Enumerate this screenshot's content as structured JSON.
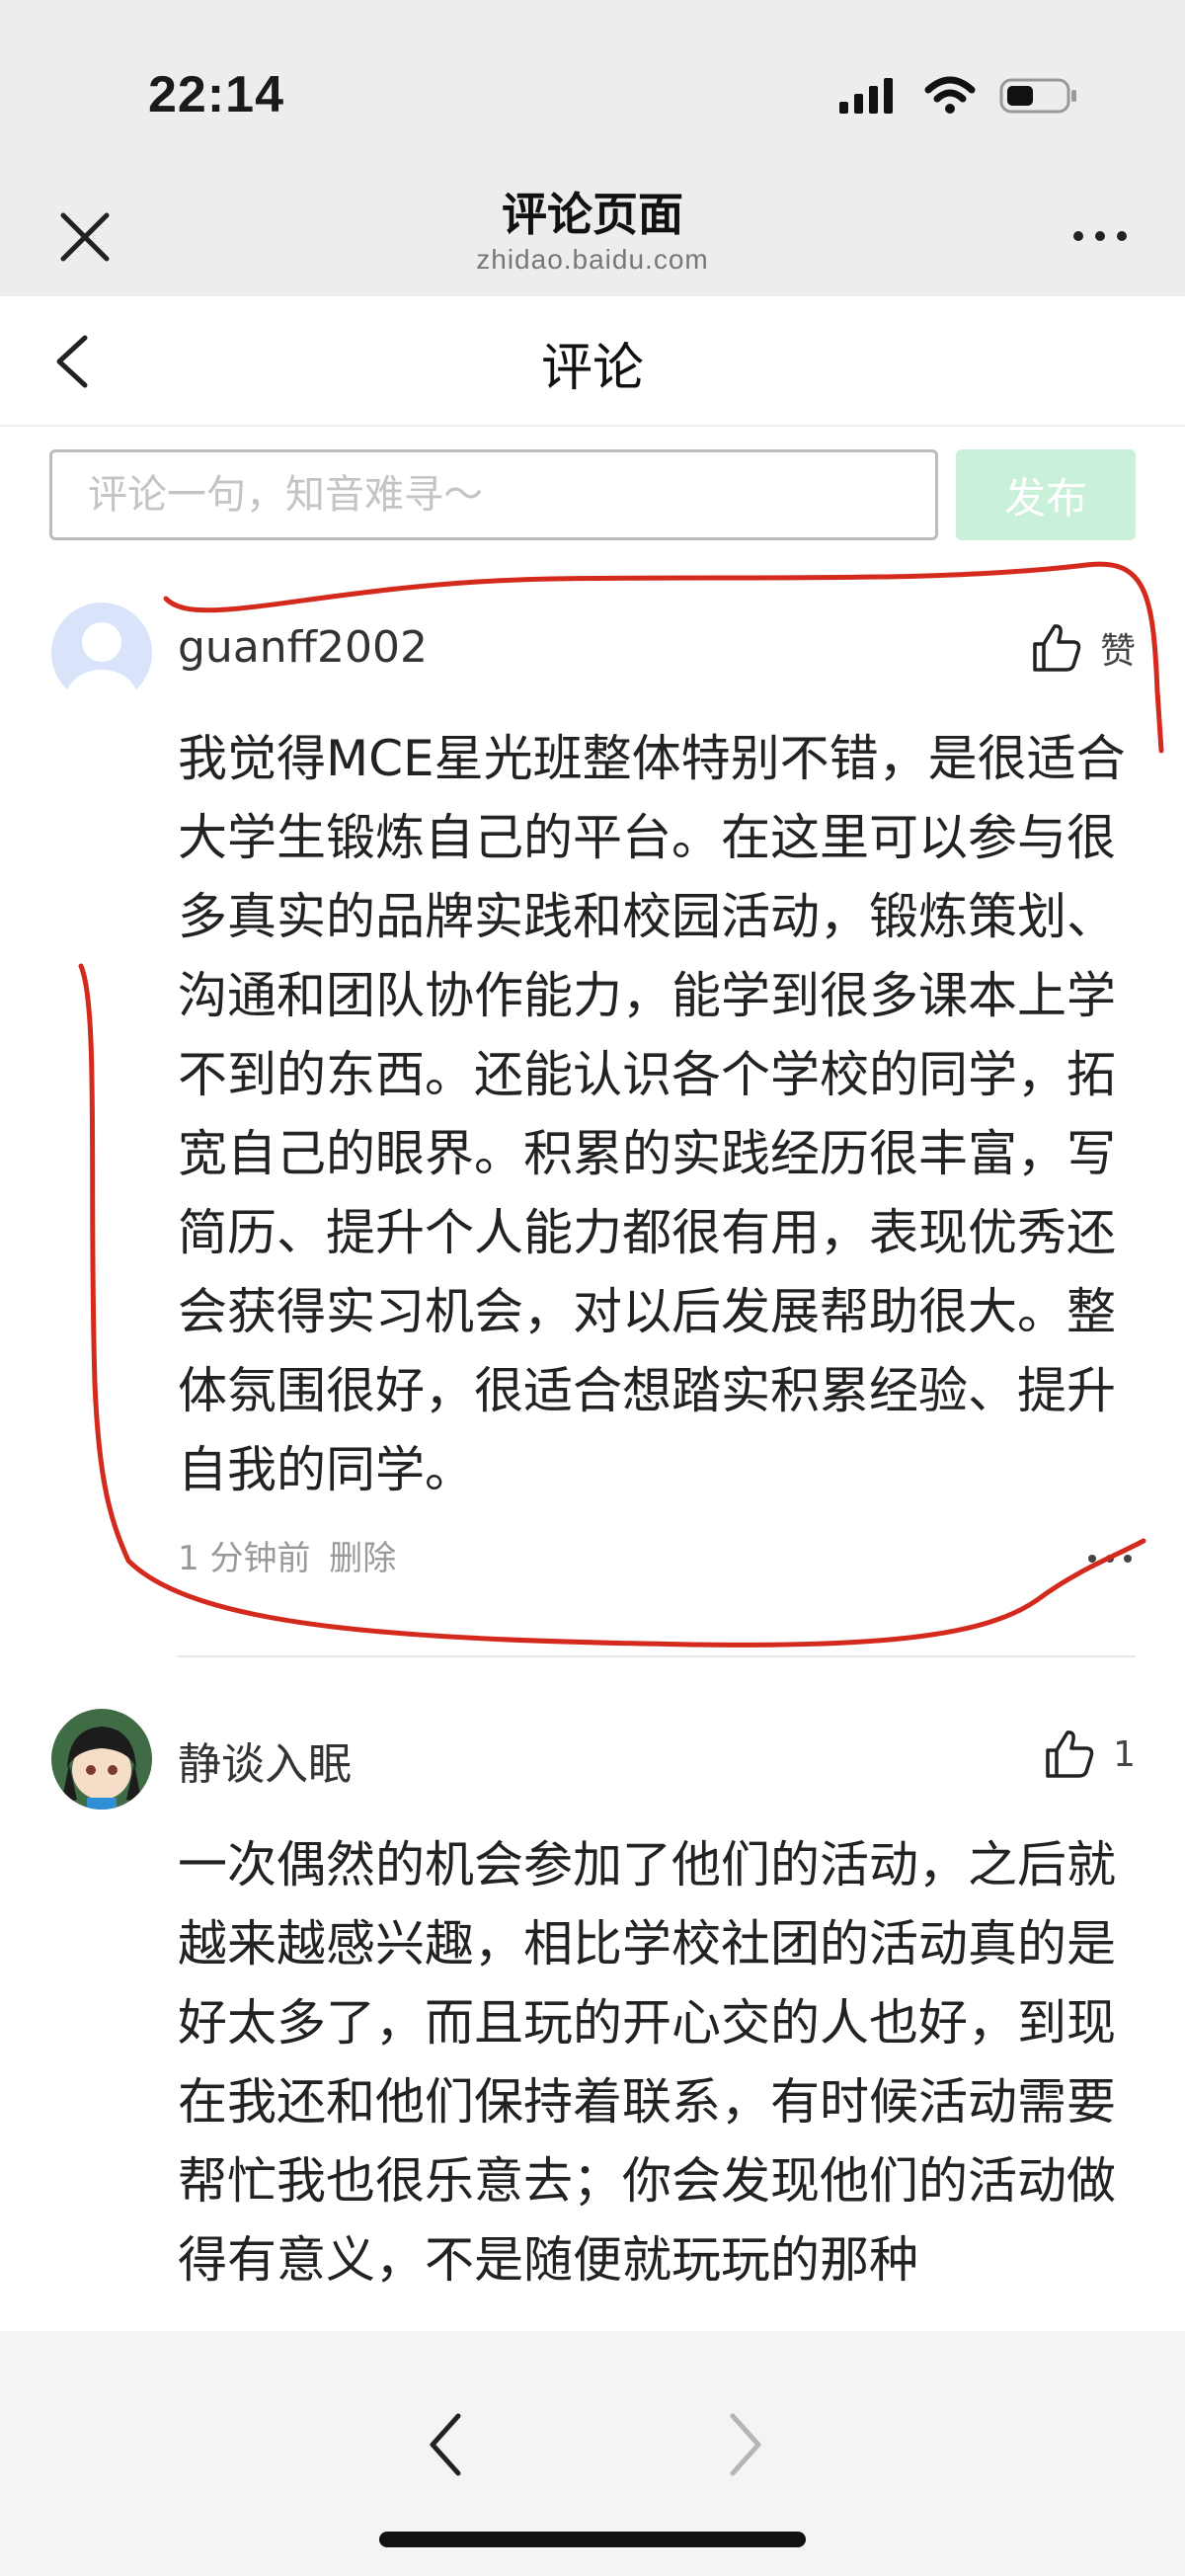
{
  "status_bar": {
    "time": "22:14"
  },
  "browser": {
    "title": "评论页面",
    "domain": "zhidao.baidu.com"
  },
  "header": {
    "title": "评论"
  },
  "comment_form": {
    "placeholder": "评论一句，知音难寻～",
    "publish_label": "发布"
  },
  "comments": [
    {
      "username": "guanff2002",
      "like_label": "赞",
      "text": "我觉得MCE星光班整体特别不错，是很适合大学生锻炼自己的平台。在这里可以参与很多真实的品牌实践和校园活动，锻炼策划、沟通和团队协作能力，能学到很多课本上学不到的东西。还能认识各个学校的同学，拓宽自己的眼界。积累的实践经历很丰富，写简历、提升个人能力都很有用，表现优秀还会获得实习机会，对以后发展帮助很大。整体氛围很好，很适合想踏实积累经验、提升自我的同学。",
      "time": "1 分钟前",
      "delete_label": "删除"
    },
    {
      "username": "静谈入眠",
      "like_count": "1",
      "text": "一次偶然的机会参加了他们的活动，之后就越来越感兴趣，相比学校社团的活动真的是好太多了，而且玩的开心交的人也好，到现在我还和他们保持着联系，有时候活动需要帮忙我也很乐意去；你会发现他们的活动做得有意义，不是随便就玩玩的那种"
    }
  ],
  "colors": {
    "annotation": "#d42a1e",
    "publish_bg": "#c9f0d9",
    "bar_bg": "#ededed"
  }
}
